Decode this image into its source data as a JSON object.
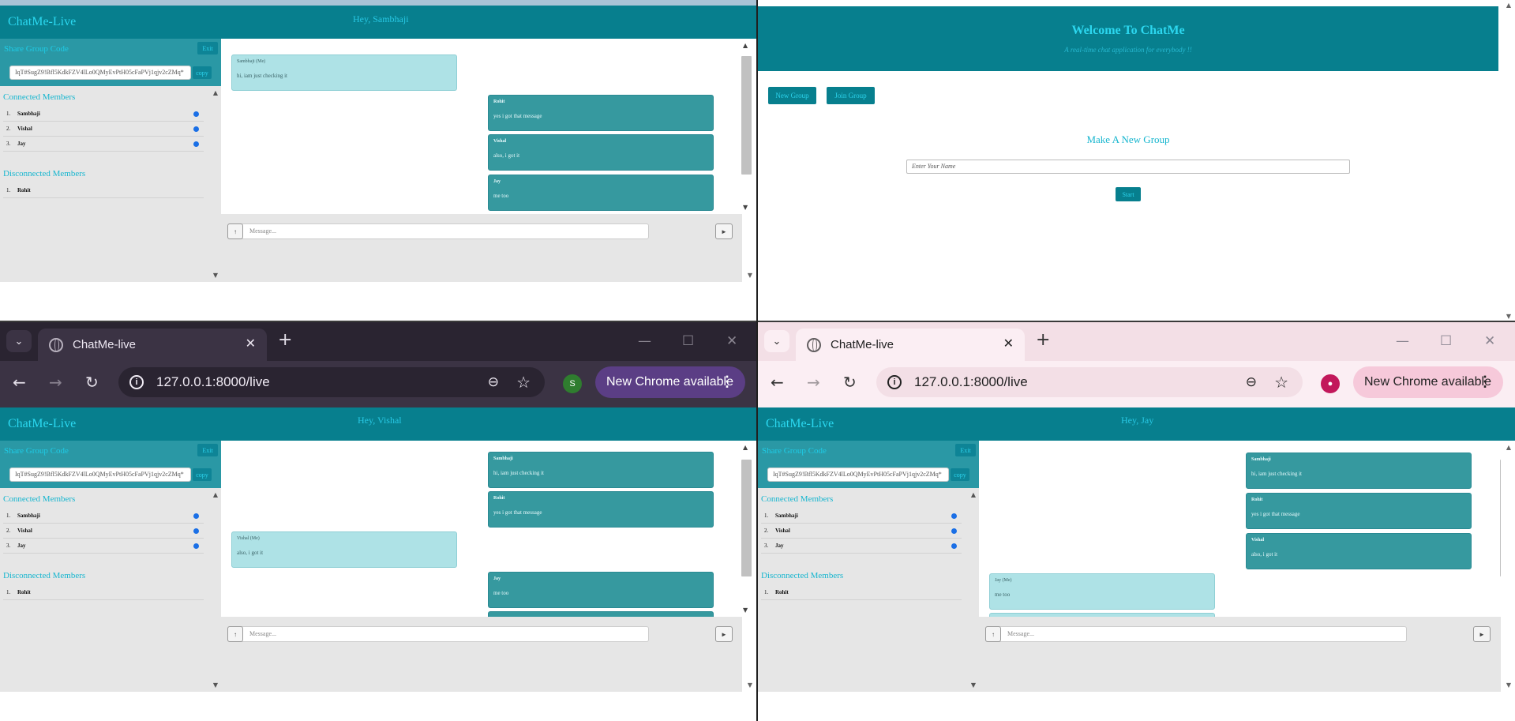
{
  "app": {
    "brand": "ChatMe-Live",
    "share_title": "Share Group Code",
    "exit_label": "Exit",
    "copy_label": "copy",
    "group_code": "IqT#SugZ9!Bfl5KdkFZV4lLo0QMyEvPtH05cFaPVj1qjv2cZMq*",
    "connected_title": "Connected Members",
    "disconnected_title": "Disconnected Members",
    "connected": [
      {
        "num": "1.",
        "name": "Sambhaji"
      },
      {
        "num": "2.",
        "name": "Vishal"
      },
      {
        "num": "3.",
        "name": "Jay"
      }
    ],
    "disconnected": [
      {
        "num": "1.",
        "name": "Rohit"
      }
    ],
    "message_placeholder": "Message...",
    "attach_icon": "↑",
    "send_icon": "►"
  },
  "windows": {
    "top_left": {
      "greeting": "Hey, Sambhaji",
      "messages": [
        {
          "sender": "Sambhaji (Me)",
          "text": "hi, iam just checking it",
          "mine": true
        },
        {
          "sender": "Rohit",
          "text": "yes i got that message",
          "mine": false
        },
        {
          "sender": "Vishal",
          "text": "also, i got it",
          "mine": false
        },
        {
          "sender": "Jay",
          "text": "me too",
          "mine": false
        }
      ]
    },
    "top_right": {
      "title": "Welcome To ChatMe",
      "subtitle": "A real-time chat application for everybody !!",
      "new_group": "New Group",
      "join_group": "Join Group",
      "make_title": "Make A New Group",
      "name_placeholder": "Enter Your Name",
      "start": "Start"
    },
    "bottom_left": {
      "tab_title": "ChatMe-live",
      "url": "127.0.0.1:8000/live",
      "update_label": "New Chrome available",
      "profile_initial": "S",
      "greeting": "Hey, Vishal",
      "messages": [
        {
          "sender": "Sambhaji",
          "text": "hi, iam just checking it",
          "mine": false
        },
        {
          "sender": "Rohit",
          "text": "yes i got that message",
          "mine": false
        },
        {
          "sender": "Vishal (Me)",
          "text": "also, i got it",
          "mine": true
        },
        {
          "sender": "Jay",
          "text": "me too",
          "mine": false
        }
      ]
    },
    "bottom_right": {
      "tab_title": "ChatMe-live",
      "url": "127.0.0.1:8000/live",
      "update_label": "New Chrome available",
      "greeting": "Hey, Jay",
      "messages": [
        {
          "sender": "Sambhaji",
          "text": "hi, iam just checking it",
          "mine": false
        },
        {
          "sender": "Rohit",
          "text": "yes i got that message",
          "mine": false
        },
        {
          "sender": "Vishal",
          "text": "also, i got it",
          "mine": false
        },
        {
          "sender": "Jay (Me)",
          "text": "me too",
          "mine": true
        }
      ]
    }
  },
  "colors": {
    "header": "#077f8e",
    "brand": "#2bd8f0",
    "bubble_other": "#36999f",
    "bubble_me": "#aee2e6"
  }
}
